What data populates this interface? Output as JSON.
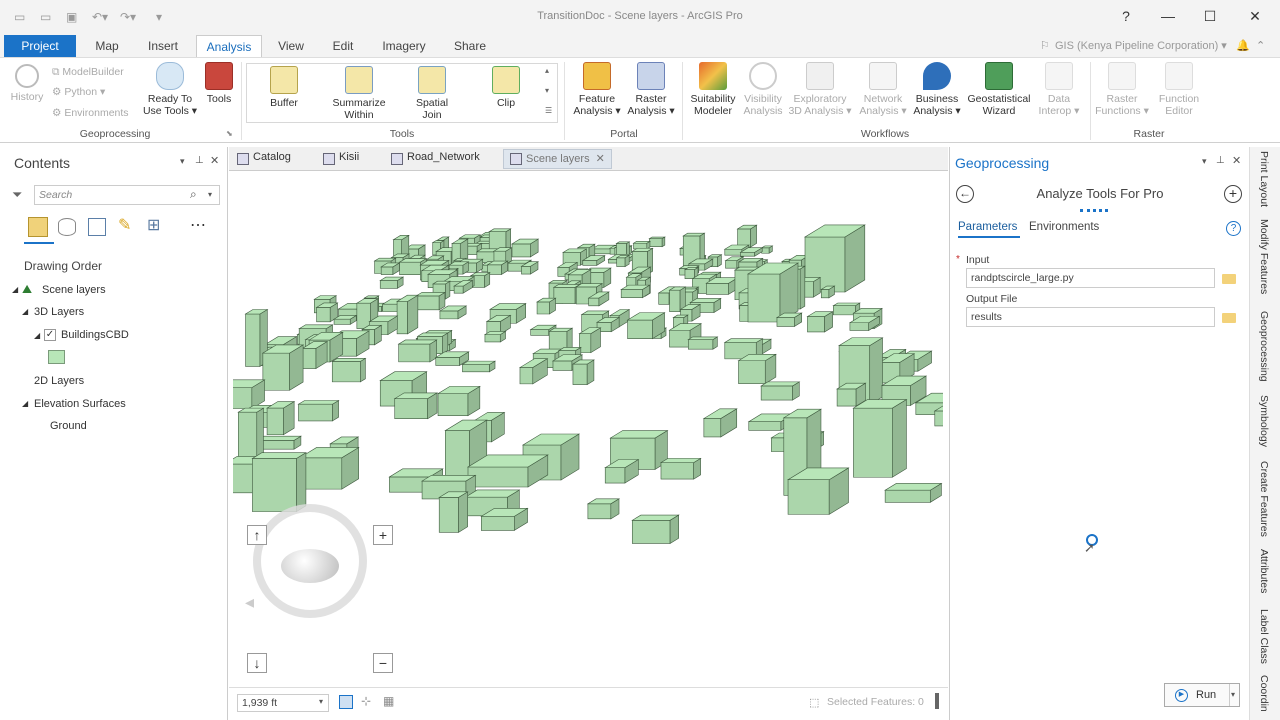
{
  "app": {
    "title": "TransitionDoc - Scene layers - ArcGIS Pro",
    "help": "?",
    "account": "GIS (Kenya Pipeline Corporation) ▾"
  },
  "ribbon_tabs": [
    "Project",
    "Map",
    "Insert",
    "Analysis",
    "View",
    "Edit",
    "Imagery",
    "Share"
  ],
  "active_tab": "Analysis",
  "ribbon": {
    "geoprocessing": {
      "history": "History",
      "modelbuilder": "ModelBuilder",
      "python": "Python ▾",
      "environments": "Environments",
      "ready_tools": "Ready To Use Tools ▾",
      "tools": "Tools",
      "group": "Geoprocessing"
    },
    "tools": {
      "buffer": "Buffer",
      "summarize": "Summarize Within",
      "spatial_join": "Spatial Join",
      "clip": "Clip",
      "group": "Tools"
    },
    "portal": {
      "feature": "Feature Analysis ▾",
      "raster": "Raster Analysis ▾",
      "group": "Portal"
    },
    "workflows": {
      "suitability": "Suitability Modeler",
      "visibility": "Visibility Analysis",
      "exploratory": "Exploratory 3D Analysis ▾",
      "network": "Network Analysis ▾",
      "business": "Business Analysis ▾",
      "geostat": "Geostatistical Wizard",
      "interop": "Data Interop ▾",
      "group": "Workflows"
    },
    "raster": {
      "functions": "Raster Functions ▾",
      "editor": "Function Editor",
      "group": "Raster"
    }
  },
  "contents": {
    "title": "Contents",
    "search_placeholder": "Search",
    "drawing_order": "Drawing Order",
    "items": {
      "scene": "Scene layers",
      "layers3d": "3D Layers",
      "buildings": "BuildingsCBD",
      "layers2d": "2D Layers",
      "elevation": "Elevation Surfaces",
      "ground": "Ground"
    }
  },
  "view_tabs": [
    "Catalog",
    "Kisii",
    "Road_Network",
    "Scene layers"
  ],
  "map_status": {
    "scale": "1,939 ft",
    "selected": "Selected Features: 0"
  },
  "geoprocessing": {
    "title": "Geoprocessing",
    "tool": "Analyze Tools For Pro",
    "tab_params": "Parameters",
    "tab_env": "Environments",
    "input_label": "Input",
    "input_value": "randptscircle_large.py",
    "output_label": "Output File",
    "output_value": "results",
    "run": "Run"
  },
  "side_tabs": [
    "Print Layout",
    "Modify Features",
    "Geoprocessing",
    "Symbology",
    "Create Features",
    "Attributes",
    "Label Class",
    "Coordin"
  ],
  "colors": {
    "accent": "#1b73c8",
    "building_fill": "#b8e6b8",
    "building_stroke": "#3f5a3f"
  }
}
